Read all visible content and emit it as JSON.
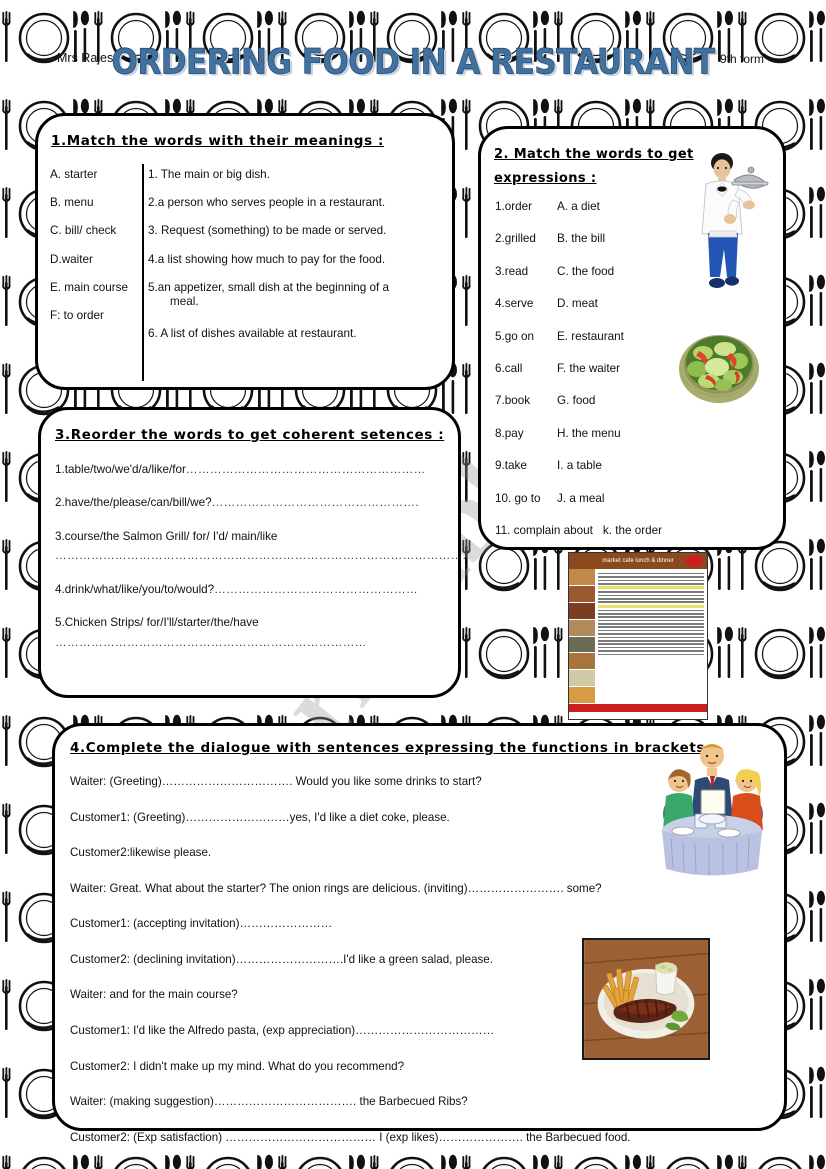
{
  "header": {
    "teacher": "Mrs Rajes",
    "level": "9th form",
    "title": "ORDERING FOOD IN A RESTAURANT",
    "title_color": "#41729f"
  },
  "exercise1": {
    "title": "1.Match the words with their meanings :",
    "left": [
      "A.  starter",
      "B.  menu",
      "C. bill/ check",
      "D.waiter",
      "E. main course",
      "F: to order"
    ],
    "right": [
      "1. The main or big dish.",
      "2.a person who serves people in a restaurant.",
      "3.  Request (something) to be made or served.",
      "4.a list showing how much to pay for the food.",
      "5.an appetizer, small dish at the  beginning of a",
      "6. A list of dishes available at restaurant."
    ],
    "right5_cont": "meal."
  },
  "exercise2": {
    "title": "2.  Match the words to get expressions :",
    "pairs": [
      {
        "left": "1.order",
        "right": "A. a diet"
      },
      {
        "left": "2.grilled",
        "right": "B. the bill"
      },
      {
        "left": "3.read",
        "right": "C. the food"
      },
      {
        "left": "4.serve",
        "right": "D. meat"
      },
      {
        "left": "5.go on",
        "right": "E. restaurant"
      },
      {
        "left": "6.call",
        "right": "F. the waiter"
      },
      {
        "left": "7.book",
        "right": "G. food"
      },
      {
        "left": "8.pay",
        "right": "H. the menu"
      },
      {
        "left": "9.take",
        "right": "I. a table"
      },
      {
        "left": "10. go to",
        "right": "J.  a meal"
      },
      {
        "left": "11. complain about",
        "right": "k. the order"
      }
    ],
    "waiter_alt": "waiter-holding-cloche",
    "salad_alt": "green-salad-bowl"
  },
  "exercise3": {
    "title": "3.Reorder the words to get coherent setences :",
    "items": [
      {
        "text": "1.table/two/we'd/a/like/for",
        "dots": "……………………………………………………",
        "wrap": false
      },
      {
        "text": "2.have/the/please/can/bill/we?",
        "dots": "…………………………………………….",
        "wrap": false
      },
      {
        "text": "3.course/the Salmon Grill/ for/ I'd/ main/like",
        "dots": "………………………………………………………………………………………….",
        "wrap": true
      },
      {
        "text": "4.drink/what/like/you/to/would?",
        "dots": "……………………………………………",
        "wrap": false
      },
      {
        "text": "5.Chicken Strips/ for/I'll/starter/the/have",
        "dots": "……………………………………………………………………",
        "wrap": true
      }
    ]
  },
  "exercise4": {
    "title": "4.Complete the dialogue with sentences expressing the functions in brackets :",
    "lines": [
      "Waiter: (Greeting)……………………………. Would you like some drinks to start?",
      "Customer1: (Greeting)………………………yes, I'd like a diet coke, please.",
      "Customer2:likewise please.",
      "Waiter: Great. What about the starter? The onion rings are delicious. (inviting)……………………. some?",
      "Customer1: (accepting invitation)……………………",
      "Customer2: (declining invitation)……………………….I'd like a green salad, please.",
      "Waiter: and for the main course?",
      "Customer1: I'd like the Alfredo pasta, (exp appreciation)………………………………",
      "Customer2: I didn't make up my mind. What do you recommend?",
      "Waiter: (making suggestion)………………………………. the Barbecued Ribs?",
      "Customer2: (Exp satisfaction) ………………………………… I (exp likes)…………………. the Barbecued food."
    ],
    "diners_alt": "diners-at-table",
    "ribs_alt": "barbecued-ribs-plate"
  },
  "menu_card": {
    "heading": "market cafe lunch & dinner"
  },
  "watermark": {
    "text": "ESLprintables.com"
  }
}
